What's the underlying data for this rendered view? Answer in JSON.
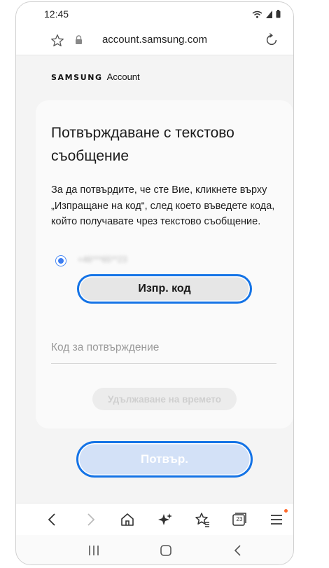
{
  "status_bar": {
    "time": "12:45"
  },
  "browser": {
    "url": "account.samsung.com"
  },
  "brand": {
    "samsung": "SAMSUNG",
    "account": "Account"
  },
  "card": {
    "title": "Потвърждаване с текстово съобщение",
    "description": "За да потвърдите, че сте Вие, кликнете върху „Изпращане на код“, след което въведете кода, който получавате чрез текстово съобщение.",
    "phone_number_masked": "+46***65**23",
    "send_code_label": "Изпр. код",
    "code_placeholder": "Код за потвърждение",
    "extend_time_label": "Удължаване на времето"
  },
  "confirm_label": "Потвър.",
  "toolbar": {
    "tabs_count": "23"
  },
  "colors": {
    "accent_blue": "#1473e6",
    "radio_blue": "#3d7df0",
    "confirm_disabled_bg": "#d3e1f7",
    "menu_badge": "#ff6a2b"
  },
  "icons": [
    "star-icon",
    "lock-icon",
    "reload-icon",
    "back-icon",
    "forward-icon",
    "home-icon",
    "sparkle-icon",
    "bookmarks-icon",
    "tabs-icon",
    "menu-icon",
    "recents-icon",
    "home-nav-icon",
    "back-nav-icon"
  ]
}
